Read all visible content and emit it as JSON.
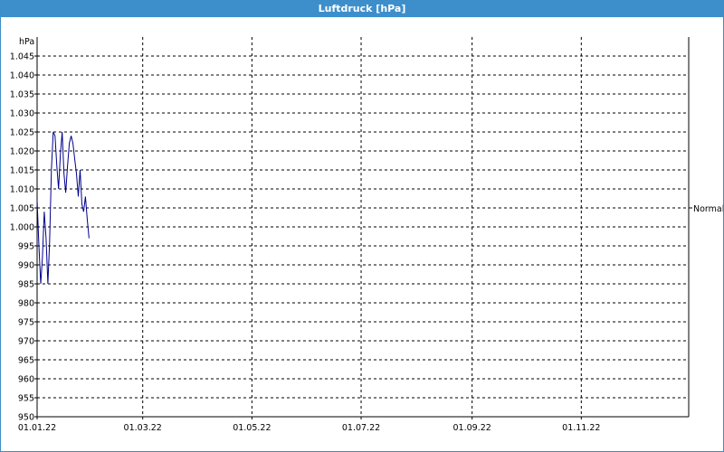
{
  "window": {
    "title": "Luftdruck [hPa]"
  },
  "colors": {
    "titlebar": "#3d8fcc",
    "series": "#00008b",
    "grid": "#000000",
    "reference": "#000000"
  },
  "chart_data": {
    "type": "line",
    "title": "Luftdruck [hPa]",
    "ylabel": "hPa",
    "xlabel": "",
    "grid": true,
    "ylim": [
      950,
      1050
    ],
    "y_ticks": [
      950,
      955,
      960,
      965,
      970,
      975,
      980,
      985,
      990,
      995,
      1000,
      1005,
      1010,
      1015,
      1020,
      1025,
      1030,
      1035,
      1040,
      1045
    ],
    "y_tick_labels": [
      "950",
      "955",
      "960",
      "965",
      "970",
      "975",
      "980",
      "985",
      "990",
      "995",
      "1.000",
      "1.005",
      "1.010",
      "1.015",
      "1.020",
      "1.025",
      "1.030",
      "1.035",
      "1.040",
      "1.045"
    ],
    "xlim": [
      "2022-01-01",
      "2022-12-31"
    ],
    "x_ticks": [
      "2022-01-01",
      "2022-03-01",
      "2022-05-01",
      "2022-07-01",
      "2022-09-01",
      "2022-11-01"
    ],
    "x_tick_labels": [
      "01.01.22",
      "01.03.22",
      "01.05.22",
      "01.07.22",
      "01.09.22",
      "01.11.22"
    ],
    "reference_lines": [
      {
        "label": "Normal",
        "y": 1005
      }
    ],
    "series": [
      {
        "x": [
          "2022-01-01",
          "2022-01-02",
          "2022-01-03",
          "2022-01-04",
          "2022-01-05",
          "2022-01-06",
          "2022-01-07",
          "2022-01-08",
          "2022-01-09",
          "2022-01-10",
          "2022-01-11",
          "2022-01-12",
          "2022-01-13",
          "2022-01-14",
          "2022-01-15",
          "2022-01-16",
          "2022-01-17",
          "2022-01-18",
          "2022-01-19",
          "2022-01-20",
          "2022-01-21",
          "2022-01-22",
          "2022-01-23",
          "2022-01-24",
          "2022-01-25",
          "2022-01-26",
          "2022-01-27",
          "2022-01-28",
          "2022-01-29",
          "2022-01-30"
        ],
        "y": [
          1007,
          995,
          985,
          992,
          1004,
          997,
          985,
          996,
          1015,
          1025,
          1024,
          1016,
          1010,
          1019,
          1025,
          1014,
          1009,
          1016,
          1022,
          1024,
          1022,
          1018,
          1014,
          1008,
          1015,
          1006,
          1004,
          1008,
          1002,
          997
        ]
      }
    ]
  }
}
